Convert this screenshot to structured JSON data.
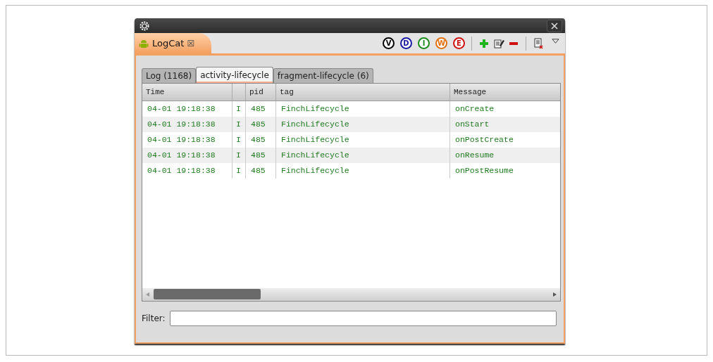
{
  "view_tab": {
    "label": "LogCat",
    "close": "☒"
  },
  "level_buttons": [
    {
      "label": "V",
      "color": "#000000"
    },
    {
      "label": "D",
      "color": "#1a1aa0"
    },
    {
      "label": "I",
      "color": "#1a8a1a"
    },
    {
      "label": "W",
      "color": "#e07010"
    },
    {
      "label": "E",
      "color": "#d01010"
    }
  ],
  "filter_tabs": [
    {
      "label": "Log (1168)",
      "selected": false
    },
    {
      "label": "activity-lifecycle",
      "selected": true
    },
    {
      "label": "fragment-lifecycle (6)",
      "selected": false
    }
  ],
  "table": {
    "columns": [
      "Time",
      "",
      "pid",
      "tag",
      "Message"
    ],
    "rows": [
      [
        "04-01 19:18:38",
        "I",
        "485",
        "FinchLifecycle",
        "onCreate"
      ],
      [
        "04-01 19:18:38",
        "I",
        "485",
        "FinchLifecycle",
        "onStart"
      ],
      [
        "04-01 19:18:38",
        "I",
        "485",
        "FinchLifecycle",
        "onPostCreate"
      ],
      [
        "04-01 19:18:38",
        "I",
        "485",
        "FinchLifecycle",
        "onResume"
      ],
      [
        "04-01 19:18:38",
        "I",
        "485",
        "FinchLifecycle",
        "onPostResume"
      ]
    ]
  },
  "filter": {
    "label": "Filter:"
  }
}
